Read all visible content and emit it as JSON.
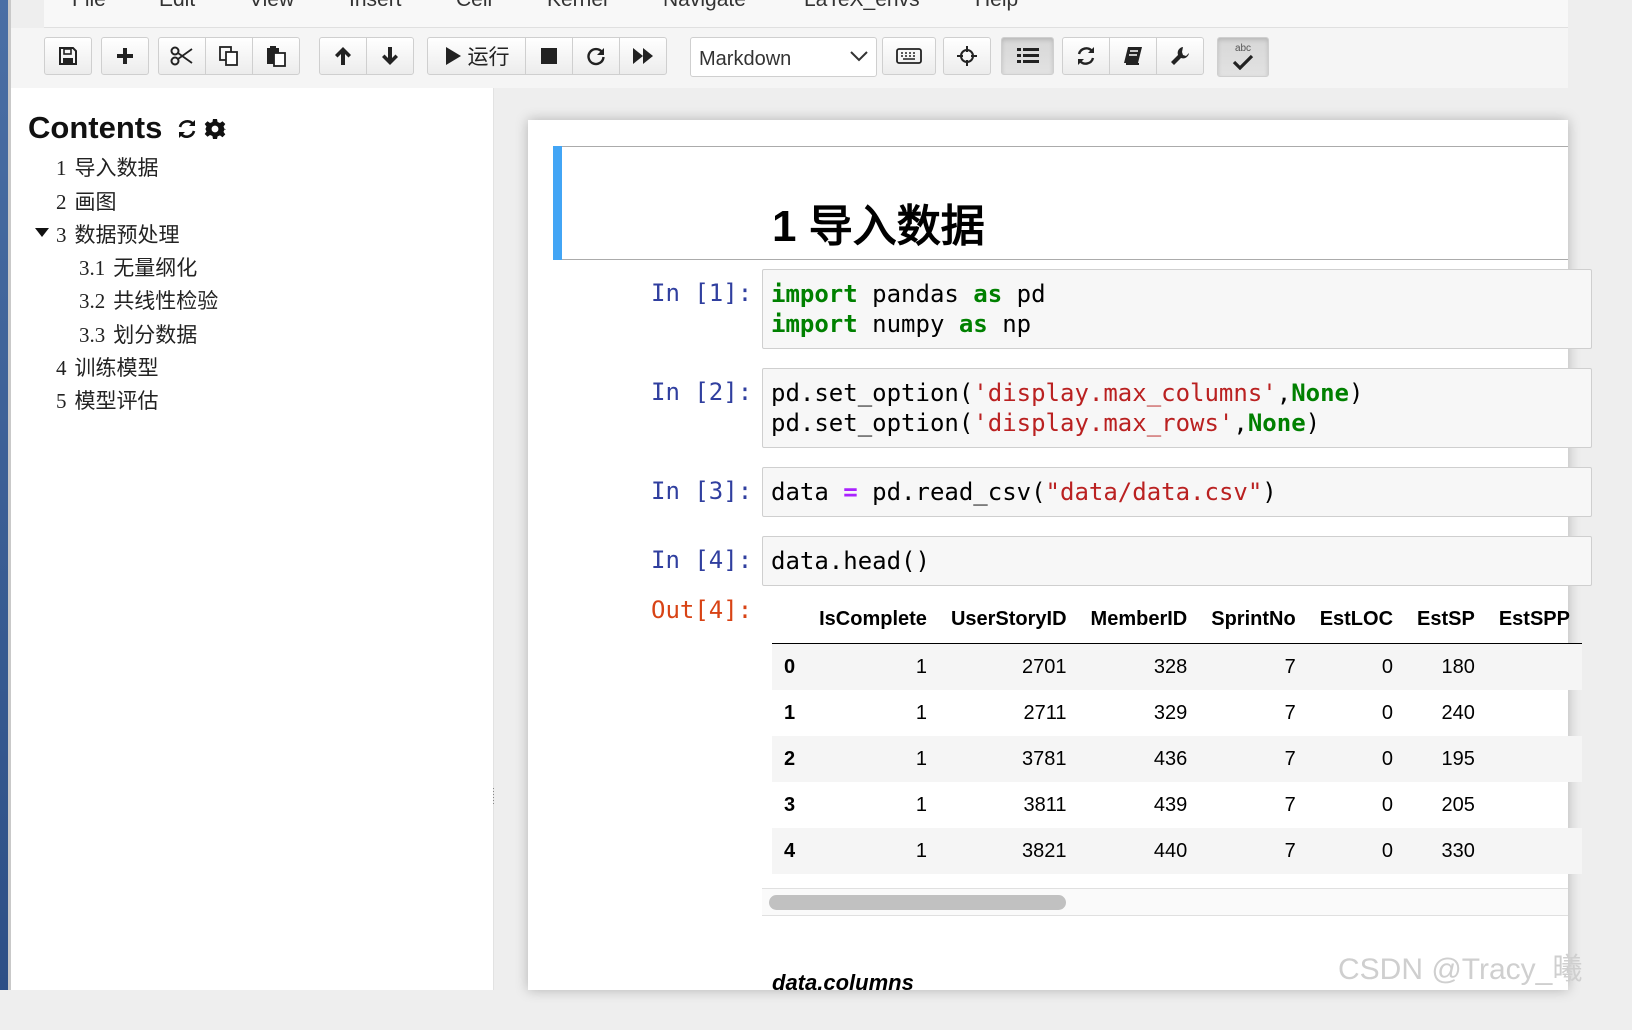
{
  "menu": [
    "File",
    "Edit",
    "View",
    "Insert",
    "Cell",
    "Kernel",
    "Navigate",
    "LaTeX_envs",
    "Help"
  ],
  "toolbar": {
    "run_label": "运行",
    "cell_type": "Markdown",
    "spellcheck_label": "abc"
  },
  "toc": {
    "title": "Contents",
    "items": [
      {
        "num": "1",
        "label": "导入数据"
      },
      {
        "num": "2",
        "label": "画图"
      },
      {
        "num": "3",
        "label": "数据预处理"
      },
      {
        "num": "3.1",
        "label": "无量纲化"
      },
      {
        "num": "3.2",
        "label": "共线性检验"
      },
      {
        "num": "3.3",
        "label": "划分数据"
      },
      {
        "num": "4",
        "label": "训练模型"
      },
      {
        "num": "5",
        "label": "模型评估"
      }
    ]
  },
  "notebook": {
    "heading": "1  导入数据",
    "cells": [
      {
        "prompt": "In [1]:"
      },
      {
        "prompt": "In [2]:"
      },
      {
        "prompt": "In [3]:"
      },
      {
        "prompt": "In [4]:"
      }
    ],
    "code": {
      "c1": {
        "kw1": "import",
        "t1": " pandas ",
        "kw2": "as",
        "t2": " pd",
        "kw3": "import",
        "t3": " numpy ",
        "kw4": "as",
        "t4": " np"
      },
      "c2": {
        "a1": "pd.set_option(",
        "s1": "'display.max_columns'",
        "b1": ",",
        "k1": "None",
        "e1": ")",
        "a2": "pd.set_option(",
        "s2": "'display.max_rows'",
        "b2": ",",
        "k2": "None",
        "e2": ")"
      },
      "c3": {
        "a": "data ",
        "op": "=",
        "b": " pd.read_csv(",
        "s": "\"data/data.csv\"",
        "e": ")"
      },
      "c4": {
        "a": "data.head()"
      }
    },
    "out_prompt": "Out[4]:",
    "table": {
      "columns": [
        "",
        "IsComplete",
        "UserStoryID",
        "MemberID",
        "SprintNo",
        "EstLOC",
        "EstSP",
        "EstSPP"
      ],
      "rows": [
        [
          "0",
          "1",
          "2701",
          "328",
          "7",
          "0",
          "180"
        ],
        [
          "1",
          "1",
          "2711",
          "329",
          "7",
          "0",
          "240"
        ],
        [
          "2",
          "1",
          "3781",
          "436",
          "7",
          "0",
          "195"
        ],
        [
          "3",
          "1",
          "3811",
          "439",
          "7",
          "0",
          "205"
        ],
        [
          "4",
          "1",
          "3821",
          "440",
          "7",
          "0",
          "330"
        ]
      ]
    },
    "next_heading": "data.columns"
  },
  "watermark": "CSDN @Tracy_曦"
}
